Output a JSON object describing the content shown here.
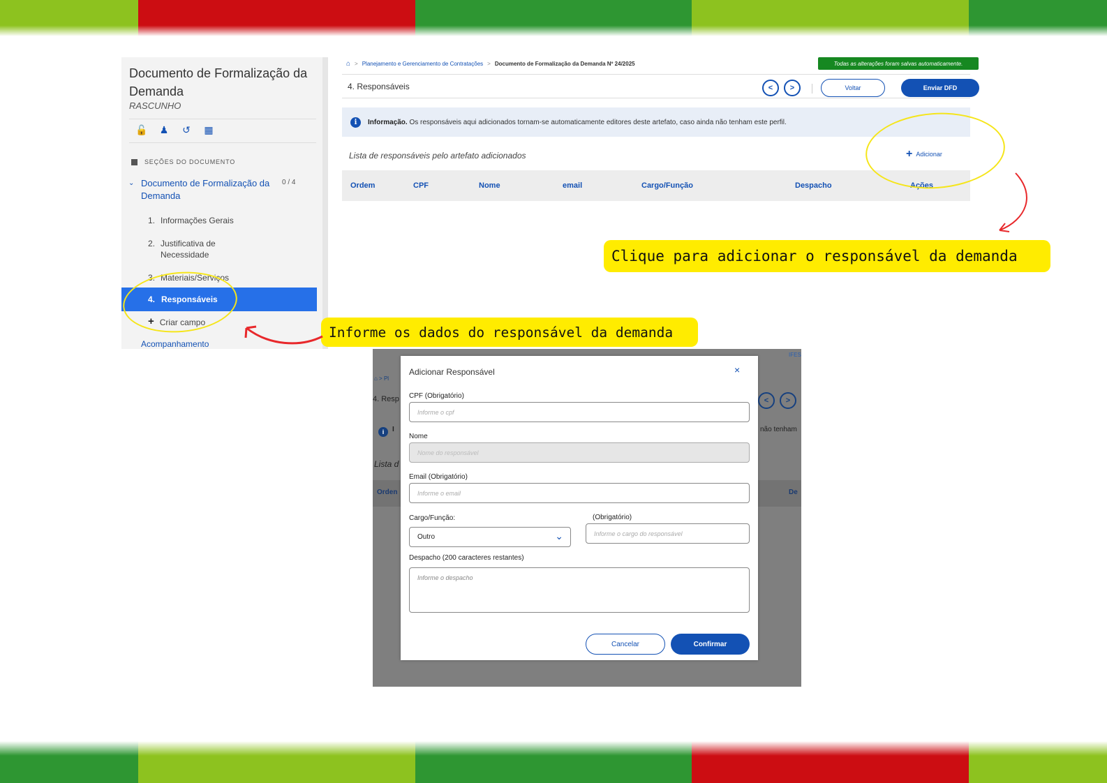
{
  "colors": {
    "stripe_green_light": "#8dc21f",
    "stripe_red": "#cc0d12",
    "stripe_green_dark": "#2e9632",
    "brand_blue": "#1351b4",
    "active_blue": "#2670e8",
    "saved_green": "#168821",
    "highlight_yellow": "#ffec00",
    "arrow_red": "#e8282b"
  },
  "sidebar": {
    "title": "Documento de Formalização da Demanda",
    "status": "RASCUNHO",
    "icons": [
      "lock-icon",
      "users-icon",
      "history-icon",
      "document-icon"
    ],
    "sections_header": "SEÇÕES DO DOCUMENTO",
    "document": {
      "label": "Documento de Formalização da Demanda",
      "count": "0 / 4"
    },
    "items": [
      {
        "num": "1.",
        "label": "Informações Gerais"
      },
      {
        "num": "2.",
        "label": "Justificativa de Necessidade"
      },
      {
        "num": "3.",
        "label": "Materiais/Serviços"
      },
      {
        "num": "4.",
        "label": "Responsáveis"
      }
    ],
    "add_field": "Criar campo",
    "acompanhamento": "Acompanhamento"
  },
  "header": {
    "breadcrumb": [
      "Planejamento e Gerenciamento de Contratações",
      "Documento de Formalização da Demanda Nº 24/2025"
    ],
    "saved_notice": "Todas as alterações foram salvas automaticamente.",
    "section_title": "4. Responsáveis",
    "voltar": "Voltar",
    "enviar": "Enviar DFD"
  },
  "info": {
    "bold": "Informação.",
    "text": "Os responsáveis aqui adicionados tornam-se automaticamente editores deste artefato, caso ainda não tenham este perfil."
  },
  "list": {
    "title": "Lista de responsáveis pelo artefato adicionados",
    "add": "Adicionar",
    "columns": [
      "Ordem",
      "CPF",
      "Nome",
      "email",
      "Cargo/Função",
      "Despacho",
      "Ações"
    ]
  },
  "callouts": {
    "add": "Clique para adicionar o responsável da demanda",
    "fill": "Informe os dados do responsável da demanda"
  },
  "background_page": {
    "corner_text": "IFES",
    "section_stub": "4. Resp",
    "info_stub": "I",
    "info_tail": "não tenham",
    "list_stub": "Lista d",
    "col_first": "Orden",
    "col_last": "De"
  },
  "modal": {
    "title": "Adicionar Responsável",
    "close": "×",
    "cpf_label": "CPF  (Obrigatório)",
    "cpf_placeholder": "Informe o cpf",
    "nome_label": "Nome",
    "nome_placeholder": "Nome do responsável",
    "email_label": "Email  (Obrigatório)",
    "email_placeholder": "Informe o email",
    "cargo_label": "Cargo/Função:",
    "cargo_value": "Outro",
    "cargo_other_label": "(Obrigatório)",
    "cargo_other_placeholder": "Informe o cargo do responsável",
    "despacho_label": "Despacho (200 caracteres restantes)",
    "despacho_placeholder": "Informe o despacho",
    "cancel": "Cancelar",
    "confirm": "Confirmar"
  }
}
